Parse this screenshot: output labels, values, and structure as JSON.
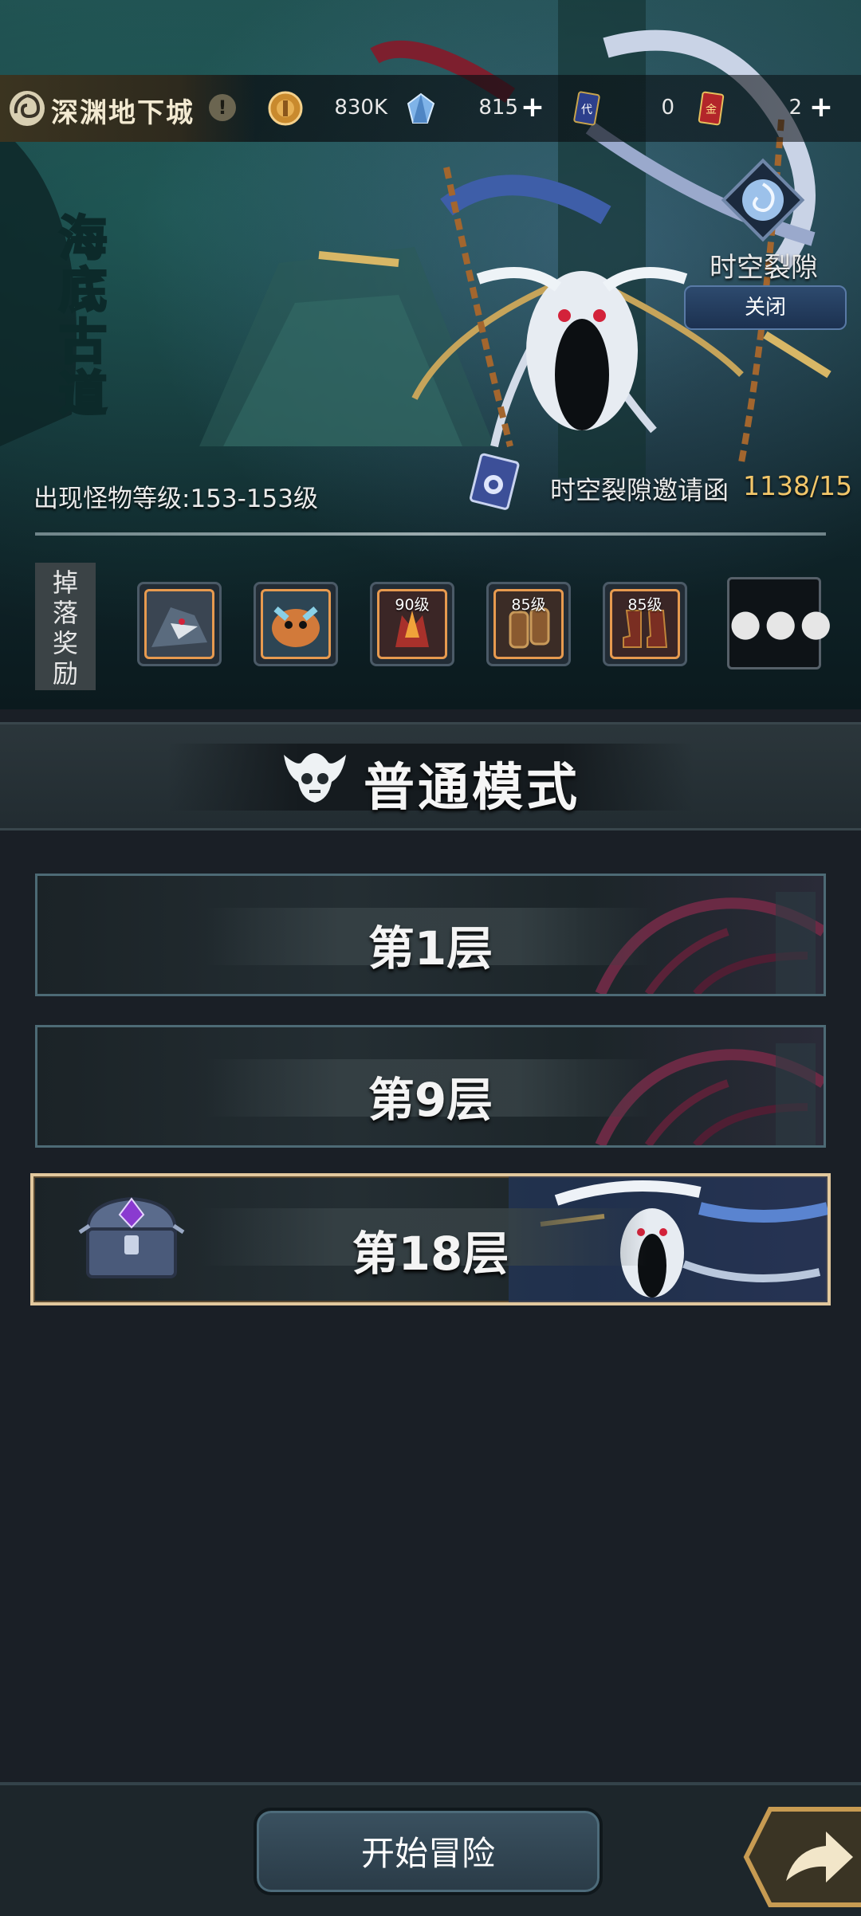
{
  "header": {
    "title": "深渊地下城",
    "info_icon": "exclamation-icon",
    "resources": [
      {
        "name": "coin",
        "icon": "gold-coin-icon",
        "value": "830K"
      },
      {
        "name": "crystal",
        "icon": "blue-crystal-icon",
        "value": "815"
      },
      {
        "name": "token-card",
        "icon": "card-dai-icon",
        "value": "0"
      },
      {
        "name": "gold-card",
        "icon": "card-jin-icon",
        "value": "2"
      }
    ]
  },
  "stage": {
    "name": "海底古道",
    "monster_level": "出现怪物等级:153-153级",
    "rift_label": "时空裂隙",
    "rift_close": "关闭",
    "invite_label": "时空裂隙邀请函",
    "invite_count": "1138/15"
  },
  "drops": {
    "label_chars": [
      "掉",
      "落",
      "奖",
      "励"
    ],
    "items": [
      {
        "icon": "shark-hero-icon",
        "level": ""
      },
      {
        "icon": "crab-hero-icon",
        "level": ""
      },
      {
        "icon": "flame-helmet-icon",
        "level": "90级"
      },
      {
        "icon": "bracer-icon",
        "level": "85级"
      },
      {
        "icon": "boots-icon",
        "level": "85级"
      }
    ],
    "more": "●●●"
  },
  "mode": {
    "title": "普通模式"
  },
  "floors": [
    {
      "name": "第1层",
      "selected": false
    },
    {
      "name": "第9层",
      "selected": false
    },
    {
      "name": "第18层",
      "selected": true
    }
  ],
  "footer": {
    "start_button": "开始冒险"
  },
  "colors": {
    "accent_gold": "#f1c66a",
    "frame_active": "#e2c89d",
    "reward_frame": "#e79a4f"
  }
}
